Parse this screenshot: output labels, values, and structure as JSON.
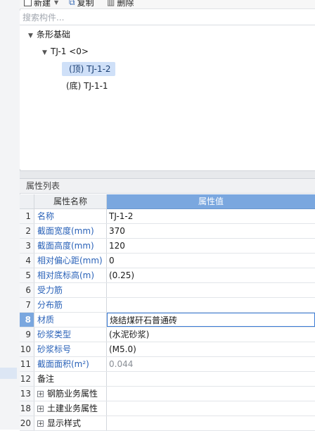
{
  "toolbar": {
    "new_label": "新建",
    "copy_label": "复制",
    "delete_label": "删除"
  },
  "search": {
    "placeholder": "搜索构件..."
  },
  "tree": {
    "root": "条形基础",
    "child": "TJ-1 <0>",
    "leaf_top": "(顶) TJ-1-2",
    "leaf_bottom": "(底) TJ-1-1"
  },
  "properties": {
    "title": "属性列表",
    "col_name": "属性名称",
    "col_value": "属性值",
    "rows": [
      {
        "num": "1",
        "name": "名称",
        "value": "TJ-1-2"
      },
      {
        "num": "2",
        "name": "截面宽度(mm)",
        "value": "370"
      },
      {
        "num": "3",
        "name": "截面高度(mm)",
        "value": "120"
      },
      {
        "num": "4",
        "name": "相对偏心距(mm)",
        "value": "0"
      },
      {
        "num": "5",
        "name": "相对底标高(m)",
        "value": "(0.25)"
      },
      {
        "num": "6",
        "name": "受力筋",
        "value": ""
      },
      {
        "num": "7",
        "name": "分布筋",
        "value": ""
      },
      {
        "num": "8",
        "name": "材质",
        "value": "烧结煤矸石普通砖"
      },
      {
        "num": "9",
        "name": "砂浆类型",
        "value": "(水泥砂浆)"
      },
      {
        "num": "10",
        "name": "砂浆标号",
        "value": "(M5.0)"
      },
      {
        "num": "11",
        "name": "截面面积(m²)",
        "value": "0.044"
      },
      {
        "num": "12",
        "name": "备注",
        "value": ""
      },
      {
        "num": "13",
        "name": "钢筋业务属性",
        "value": ""
      },
      {
        "num": "18",
        "name": "土建业务属性",
        "value": ""
      },
      {
        "num": "20",
        "name": "显示样式",
        "value": ""
      }
    ]
  },
  "colors": {
    "accent": "#7aa7df",
    "link": "#2a62b8",
    "selection": "#cfe0f8"
  },
  "icons": {
    "new": "checkbox-icon",
    "copy": "copy-icon",
    "delete": "trash-icon",
    "expand": "plus-box-icon"
  }
}
